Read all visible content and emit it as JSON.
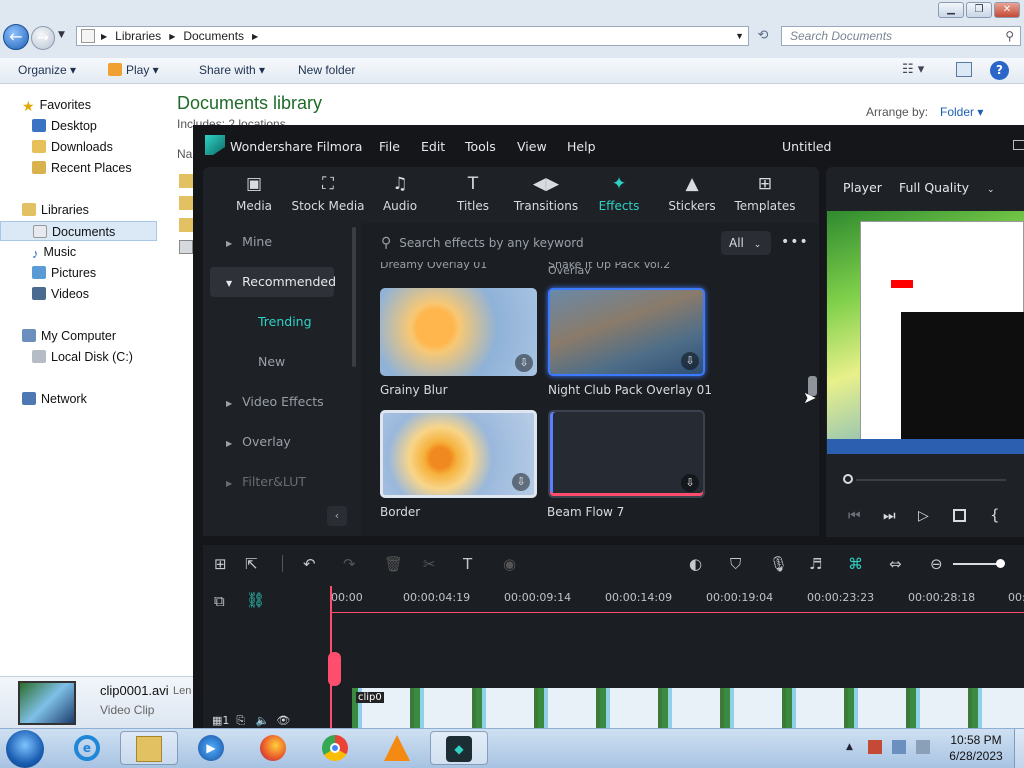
{
  "explorer": {
    "breadcrumb": [
      "Libraries",
      "Documents"
    ],
    "search_placeholder": "Search Documents",
    "commands": {
      "organize": "Organize",
      "play": "Play",
      "share": "Share with",
      "new_folder": "New folder"
    },
    "nav": {
      "favorites": "Favorites",
      "desktop": "Desktop",
      "downloads": "Downloads",
      "recent": "Recent Places",
      "libraries": "Libraries",
      "documents": "Documents",
      "music": "Music",
      "pictures": "Pictures",
      "videos": "Videos",
      "computer": "My Computer",
      "localdisk": "Local Disk (C:)",
      "network": "Network"
    },
    "library_title": "Documents library",
    "library_sub": "Includes: 2 locations",
    "arrange_label": "Arrange by:",
    "arrange_value": "Folder",
    "col_name": "Na",
    "details": {
      "filename": "clip0001.avi",
      "length_label": "Len",
      "type": "Video Clip"
    }
  },
  "filmora": {
    "app_name": "Wondershare Filmora",
    "menu": [
      "File",
      "Edit",
      "Tools",
      "View",
      "Help"
    ],
    "project": "Untitled",
    "tabs": [
      "Media",
      "Stock Media",
      "Audio",
      "Titles",
      "Transitions",
      "Effects",
      "Stickers",
      "Templates"
    ],
    "categories": {
      "mine": "Mine",
      "recommended": "Recommended",
      "trending": "Trending",
      "new": "New",
      "video_effects": "Video Effects",
      "overlay": "Overlay",
      "filter": "Filter&LUT"
    },
    "search_placeholder": "Search effects by any keyword",
    "filter_all": "All",
    "partial_labels": [
      "Dreamy Overlay 01",
      "Shake It Up Pack Vol.2 Overlay"
    ],
    "effects": [
      "Grainy Blur",
      "Night Club Pack Overlay 01",
      "Border",
      "Beam Flow 7"
    ],
    "player_label": "Player",
    "quality": "Full Quality",
    "timecodes": [
      "00:00",
      "00:00:04:19",
      "00:00:09:14",
      "00:00:14:09",
      "00:00:19:04",
      "00:00:23:23",
      "00:00:28:18",
      "00:0"
    ],
    "clip_label": "clip0",
    "track_num": "1"
  },
  "taskbar": {
    "time": "10:58 PM",
    "date": "6/28/2023"
  }
}
